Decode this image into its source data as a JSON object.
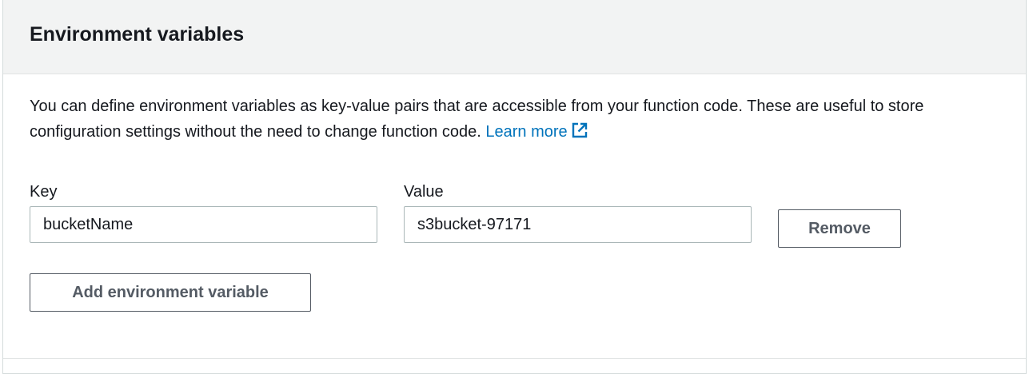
{
  "section": {
    "title": "Environment variables",
    "description": "You can define environment variables as key-value pairs that are accessible from your function code. These are useful to store configuration settings without the need to change function code.",
    "learn_more_label": "Learn more",
    "learn_more_icon": "external-link-icon",
    "colors": {
      "header_bg": "#f2f3f3",
      "link": "#0073bb",
      "button_text": "#545b64",
      "border": "#aab7b8"
    }
  },
  "variables": [
    {
      "key_label": "Key",
      "key_value": "bucketName",
      "value_label": "Value",
      "value_value": "s3bucket-97171",
      "remove_label": "Remove"
    }
  ],
  "actions": {
    "add_label": "Add environment variable"
  }
}
